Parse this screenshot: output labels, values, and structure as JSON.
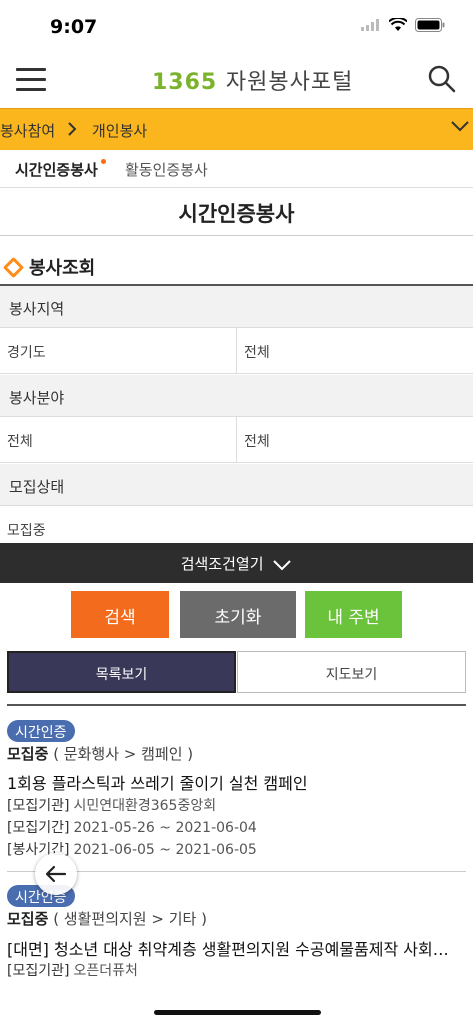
{
  "status_bar": {
    "time": "9:07"
  },
  "header": {
    "logo_number": "1365",
    "logo_text": "자원봉사포털"
  },
  "breadcrumb": {
    "level1": "봉사참여",
    "separator": ">",
    "level2": "개인봉사"
  },
  "subtabs": {
    "active": "시간인증봉사",
    "other": "활동인증봉사"
  },
  "page_title": "시간인증봉사",
  "search_section": {
    "title": "봉사조회",
    "region_label": "봉사지역",
    "region_value1": "경기도",
    "region_value2": "전체",
    "field_label": "봉사분야",
    "field_value1": "전체",
    "field_value2": "전체",
    "status_label": "모집상태",
    "status_value": "모집중",
    "toggle_label": "검색조건열기"
  },
  "buttons": {
    "search": "검색",
    "reset": "초기화",
    "nearby": "내 주변"
  },
  "view_tabs": {
    "list": "목록보기",
    "map": "지도보기"
  },
  "items": [
    {
      "badge": "시간인증",
      "status": "모집중",
      "category": "( 문화행사  > 캠페인 )",
      "title": "1회용 플라스틱과 쓰레기 줄이기 실천 캠페인",
      "org_label": "[모집기관]",
      "org": "시민연대환경365중앙회",
      "recruit_label": "[모집기간]",
      "recruit": "2021-05-26 ~ 2021-06-04",
      "service_label": "[봉사기간]",
      "service": "2021-06-05 ~ 2021-06-05"
    },
    {
      "badge": "시간인증",
      "status": "모집중",
      "category": "( 생활편의지원  > 기타 )",
      "title": "[대면] 청소년 대상 취약계층 생활편의지원 수공예물품제작 사회…",
      "org_label": "[모집기관]",
      "org": "오픈더퓨처"
    }
  ],
  "colors": {
    "accent_yellow": "#fbb51d",
    "search_orange": "#f36b1c",
    "reset_gray": "#6b6b6b",
    "nearby_green": "#6ac33a",
    "badge_blue": "#4a6db0",
    "list_tab_navy": "#3a3858"
  }
}
